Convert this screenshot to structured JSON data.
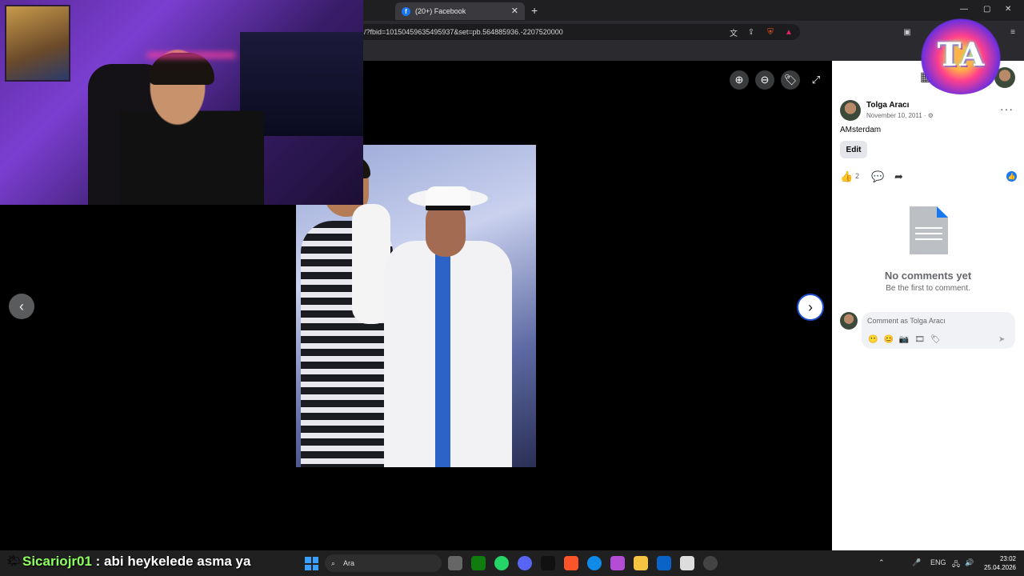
{
  "browser": {
    "tab_title": "(20+) Facebook",
    "tab_icon": "facebook-icon",
    "url": "/?fbid=10150459635495937&set=pb.564885936.-2207520000",
    "window_controls": [
      "—",
      "▢",
      "✕"
    ]
  },
  "viewer": {
    "prev": "‹",
    "next": "›",
    "zoom_in": "⊕",
    "zoom_out": "⊖",
    "tag": "🏷",
    "fullscreen": "⤢"
  },
  "post": {
    "author": "Tolga Aracı",
    "date": "November 10, 2011 · ⚙",
    "caption": "AMsterdam",
    "edit_label": "Edit",
    "like_count": "2",
    "more": "···",
    "no_comments_title": "No comments yet",
    "no_comments_sub": "Be the first to comment.",
    "comment_placeholder": "Comment as Tolga Aracı",
    "comment_tools": "😶😊📷🎞🏷",
    "send": "➤"
  },
  "overlay": {
    "logo_text": "TA",
    "chat_user": "Sicariojr01",
    "chat_message": " : abi heykelede asma ya"
  },
  "taskbar": {
    "search_placeholder": "Ara",
    "lang": "ENG",
    "time": "23:02",
    "date": "25.04.2026"
  },
  "colors": {
    "facebook_blue": "#1877f2",
    "taskbar": "#202020",
    "chat_user": "#8dff5e"
  }
}
